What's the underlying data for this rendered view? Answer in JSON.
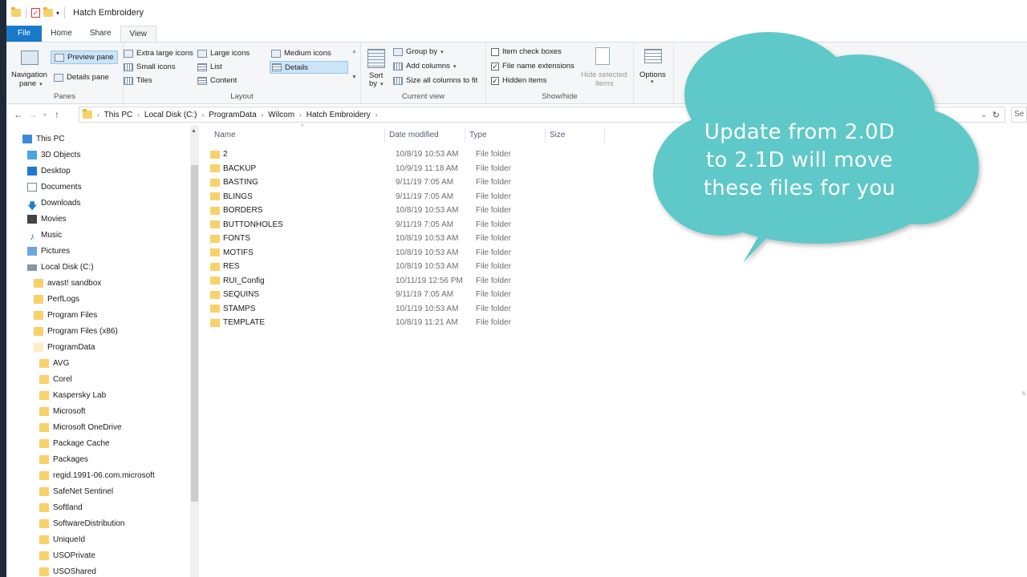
{
  "window": {
    "title": "Hatch Embroidery"
  },
  "tabs": [
    "File",
    "Home",
    "Share",
    "View"
  ],
  "ribbon": {
    "panes": {
      "navigation_pane": "Navigation",
      "navigation_pane2": "pane",
      "preview_pane": "Preview pane",
      "details_pane": "Details pane",
      "label": "Panes"
    },
    "layout": {
      "extra_large_icons": "Extra large icons",
      "large_icons": "Large icons",
      "medium_icons": "Medium icons",
      "small_icons": "Small icons",
      "list": "List",
      "details": "Details",
      "tiles": "Tiles",
      "content": "Content",
      "label": "Layout"
    },
    "current_view": {
      "sort_by": "Sort",
      "sort_by2": "by",
      "group_by": "Group by",
      "add_columns": "Add columns",
      "size_all_columns": "Size all columns to fit",
      "label": "Current view"
    },
    "show_hide": {
      "item_check_boxes": "Item check boxes",
      "file_name_extensions": "File name extensions",
      "hidden_items": "Hidden items",
      "hide_selected": "Hide selected",
      "hide_selected2": "items",
      "label": "Show/hide"
    },
    "options": "Options",
    "checks": {
      "item_check_boxes": false,
      "file_name_extensions": true,
      "hidden_items": true
    }
  },
  "address": {
    "crumbs": [
      "This PC",
      "Local Disk (C:)",
      "ProgramData",
      "Wilcom",
      "Hatch Embroidery"
    ],
    "right_text": "Se"
  },
  "nav": [
    {
      "label": "This PC"
    },
    {
      "label": "3D Objects"
    },
    {
      "label": "Desktop"
    },
    {
      "label": "Documents"
    },
    {
      "label": "Downloads"
    },
    {
      "label": "Movies"
    },
    {
      "label": "Music"
    },
    {
      "label": "Pictures"
    },
    {
      "label": "Local Disk (C:)"
    },
    {
      "label": "avast! sandbox"
    },
    {
      "label": "PerfLogs"
    },
    {
      "label": "Program Files"
    },
    {
      "label": "Program Files (x86)"
    },
    {
      "label": "ProgramData"
    },
    {
      "label": "AVG"
    },
    {
      "label": "Corel"
    },
    {
      "label": "Kaspersky Lab"
    },
    {
      "label": "Microsoft"
    },
    {
      "label": "Microsoft OneDrive"
    },
    {
      "label": "Package Cache"
    },
    {
      "label": "Packages"
    },
    {
      "label": "regid.1991-06.com.microsoft"
    },
    {
      "label": "SafeNet Sentinel"
    },
    {
      "label": "Softland"
    },
    {
      "label": "SoftwareDistribution"
    },
    {
      "label": "UniqueId"
    },
    {
      "label": "USOPrivate"
    },
    {
      "label": "USOShared"
    }
  ],
  "columns": {
    "name": "Name",
    "date": "Date modified",
    "type": "Type",
    "size": "Size"
  },
  "files": [
    {
      "name": "2",
      "date": "10/8/19 10:53 AM",
      "type": "File folder"
    },
    {
      "name": "BACKUP",
      "date": "10/9/19 11:18 AM",
      "type": "File folder"
    },
    {
      "name": "BASTING",
      "date": "9/11/19 7:05 AM",
      "type": "File folder"
    },
    {
      "name": "BLINGS",
      "date": "9/11/19 7:05 AM",
      "type": "File folder"
    },
    {
      "name": "BORDERS",
      "date": "10/8/19 10:53 AM",
      "type": "File folder"
    },
    {
      "name": "BUTTONHOLES",
      "date": "9/11/19 7:05 AM",
      "type": "File folder"
    },
    {
      "name": "FONTS",
      "date": "10/8/19 10:53 AM",
      "type": "File folder"
    },
    {
      "name": "MOTIFS",
      "date": "10/8/19 10:53 AM",
      "type": "File folder"
    },
    {
      "name": "RES",
      "date": "10/8/19 10:53 AM",
      "type": "File folder"
    },
    {
      "name": "RUI_Config",
      "date": "10/11/19 12:56 PM",
      "type": "File folder"
    },
    {
      "name": "SEQUINS",
      "date": "9/11/19 7:05 AM",
      "type": "File folder"
    },
    {
      "name": "STAMPS",
      "date": "10/1/19 10:53 AM",
      "type": "File folder"
    },
    {
      "name": "TEMPLATE",
      "date": "10/8/19 11:21 AM",
      "type": "File folder"
    }
  ],
  "callout": {
    "line1": "Update from 2.0D",
    "line2": "to 2.1D will move",
    "line3": "these files for you",
    "color": "#5ec8c8"
  },
  "colors": {
    "accent": "#1979ca",
    "selected": "#cce4f7"
  }
}
